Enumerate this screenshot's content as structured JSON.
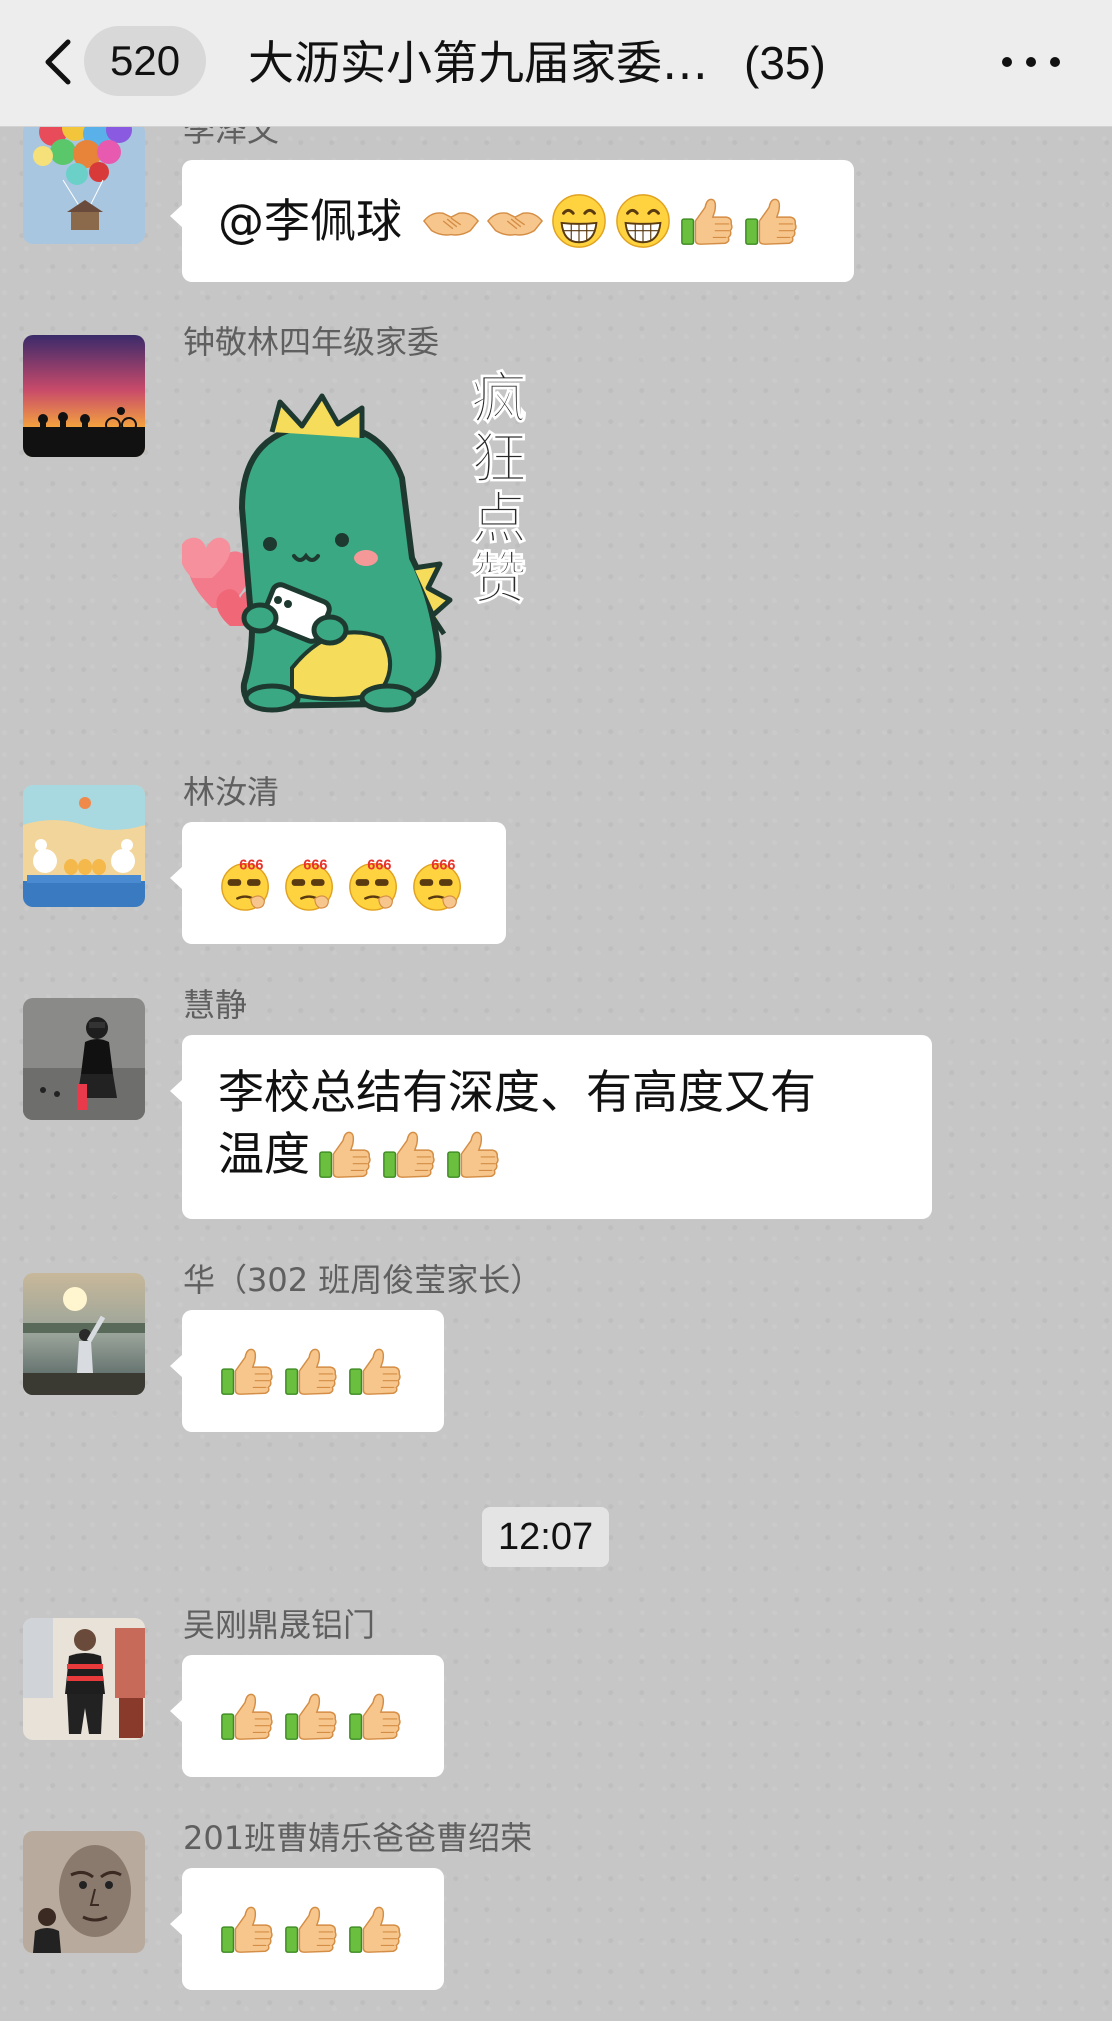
{
  "header": {
    "back_count": "520",
    "title": "大沥实小第九届家委…",
    "member_count": "(35)"
  },
  "messages": [
    {
      "sender": "李泽文",
      "text": "@李佩球",
      "emojis": [
        "handshake-icon",
        "handshake-icon",
        "grin-icon",
        "grin-icon",
        "thumbs-up-icon",
        "thumbs-up-icon"
      ]
    },
    {
      "sender": "钟敬林四年级家委",
      "sticker_text": "疯狂点赞"
    },
    {
      "sender": "林汝清",
      "emojis": [
        "666-icon",
        "666-icon",
        "666-icon",
        "666-icon"
      ]
    },
    {
      "sender": "慧静",
      "text_line1": "李校总结有深度、有高度又有",
      "text_line2": "温度",
      "emojis": [
        "thumbs-up-icon",
        "thumbs-up-icon",
        "thumbs-up-icon"
      ]
    },
    {
      "sender": "华（302 班周俊莹家长）",
      "emojis": [
        "thumbs-up-icon",
        "thumbs-up-icon",
        "thumbs-up-icon"
      ]
    },
    {
      "sender": "吴刚鼎晟铝门",
      "emojis": [
        "thumbs-up-icon",
        "thumbs-up-icon",
        "thumbs-up-icon"
      ]
    },
    {
      "sender": "201班曹婧乐爸爸曹绍荣",
      "emojis": [
        "thumbs-up-icon",
        "thumbs-up-icon",
        "thumbs-up-icon"
      ]
    }
  ],
  "timestamp": "12:07",
  "colors": {
    "header_bg": "#ededed",
    "chat_bg": "#c6c6c6",
    "bubble_bg": "#ffffff",
    "sender_text": "#5f5f5f",
    "dino_green": "#3aa883"
  }
}
